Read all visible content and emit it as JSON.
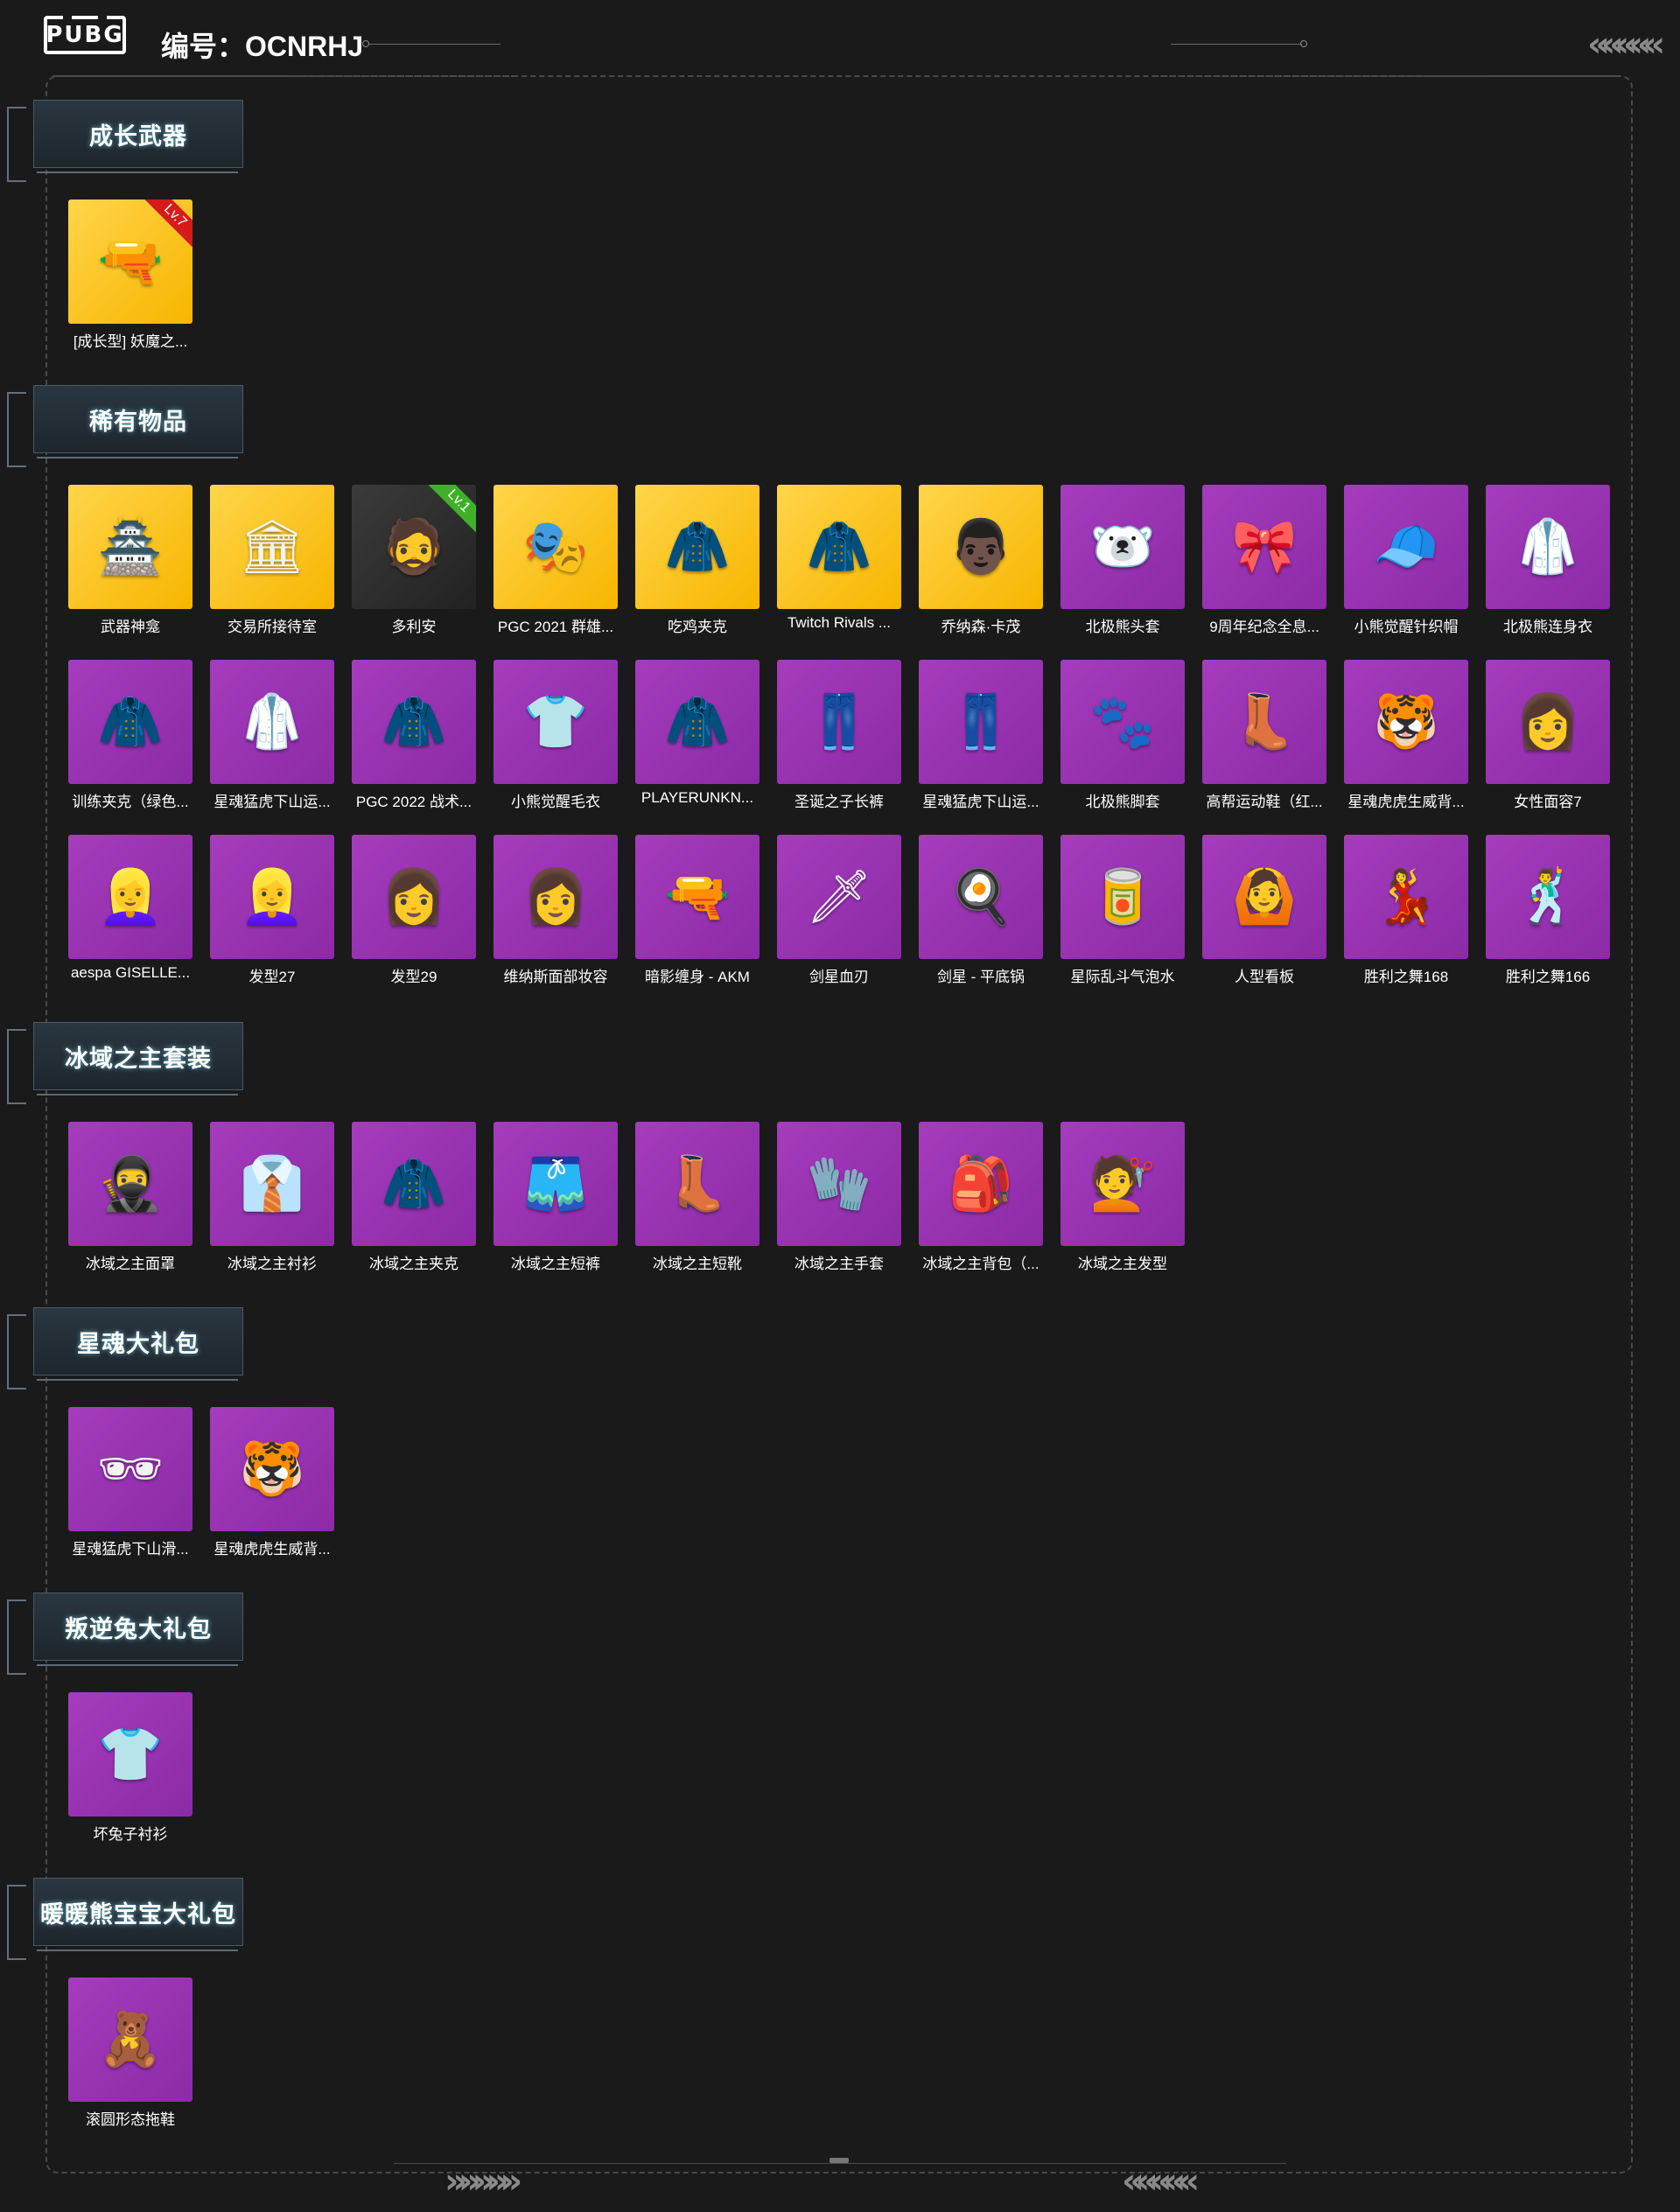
{
  "header": {
    "logo": "PUBG",
    "id_label": "编号：OCNRHJ"
  },
  "sections": [
    {
      "title": "成长武器",
      "items": [
        {
          "name": "[成长型] 妖魔之...",
          "bg": "gold",
          "icon": "🔫",
          "badge": "Lv.7",
          "badge_color": "red"
        }
      ]
    },
    {
      "title": "稀有物品",
      "items": [
        {
          "name": "武器神龛",
          "bg": "gold",
          "icon": "🏯"
        },
        {
          "name": "交易所接待室",
          "bg": "gold",
          "icon": "🏛"
        },
        {
          "name": "多利安",
          "bg": "dark",
          "icon": "🧔",
          "badge": "Lv.1",
          "badge_color": "green"
        },
        {
          "name": "PGC 2021 群雄...",
          "bg": "gold",
          "icon": "🎭"
        },
        {
          "name": "吃鸡夹克",
          "bg": "gold",
          "icon": "🧥"
        },
        {
          "name": "Twitch Rivals ...",
          "bg": "gold",
          "icon": "🧥"
        },
        {
          "name": "乔纳森·卡茂",
          "bg": "gold",
          "icon": "👨🏿"
        },
        {
          "name": "北极熊头套",
          "bg": "purple",
          "icon": "🐻‍❄️"
        },
        {
          "name": "9周年纪念全息...",
          "bg": "purple",
          "icon": "🎀"
        },
        {
          "name": "小熊觉醒针织帽",
          "bg": "purple",
          "icon": "🧢"
        },
        {
          "name": "北极熊连身衣",
          "bg": "purple",
          "icon": "🥼"
        },
        {
          "name": "训练夹克（绿色...",
          "bg": "purple",
          "icon": "🧥"
        },
        {
          "name": "星魂猛虎下山运...",
          "bg": "purple",
          "icon": "🥼"
        },
        {
          "name": "PGC 2022 战术...",
          "bg": "purple",
          "icon": "🧥"
        },
        {
          "name": "小熊觉醒毛衣",
          "bg": "purple",
          "icon": "👕"
        },
        {
          "name": "PLAYERUNKN...",
          "bg": "purple",
          "icon": "🧥"
        },
        {
          "name": "圣诞之子长裤",
          "bg": "purple",
          "icon": "👖"
        },
        {
          "name": "星魂猛虎下山运...",
          "bg": "purple",
          "icon": "👖"
        },
        {
          "name": "北极熊脚套",
          "bg": "purple",
          "icon": "🐾"
        },
        {
          "name": "高帮运动鞋（红...",
          "bg": "purple",
          "icon": "👢"
        },
        {
          "name": "星魂虎虎生威背...",
          "bg": "purple",
          "icon": "🐯"
        },
        {
          "name": "女性面容7",
          "bg": "purple",
          "icon": "👩"
        },
        {
          "name": "aespa GISELLE...",
          "bg": "purple",
          "icon": "👱‍♀️"
        },
        {
          "name": "发型27",
          "bg": "purple",
          "icon": "👱‍♀️"
        },
        {
          "name": "发型29",
          "bg": "purple",
          "icon": "👩"
        },
        {
          "name": "维纳斯面部妆容",
          "bg": "purple",
          "icon": "👩"
        },
        {
          "name": "暗影缠身 - AKM",
          "bg": "purple",
          "icon": "🔫"
        },
        {
          "name": "剑星血刃",
          "bg": "purple",
          "icon": "🗡"
        },
        {
          "name": "剑星 - 平底锅",
          "bg": "purple",
          "icon": "🍳"
        },
        {
          "name": "星际乱斗气泡水",
          "bg": "purple",
          "icon": "🥫"
        },
        {
          "name": "人型看板",
          "bg": "purple",
          "icon": "🙆"
        },
        {
          "name": "胜利之舞168",
          "bg": "purple",
          "icon": "💃"
        },
        {
          "name": "胜利之舞166",
          "bg": "purple",
          "icon": "🕺"
        }
      ]
    },
    {
      "title": "冰域之主套装",
      "items": [
        {
          "name": "冰域之主面罩",
          "bg": "purple",
          "icon": "🥷"
        },
        {
          "name": "冰域之主衬衫",
          "bg": "purple",
          "icon": "👔"
        },
        {
          "name": "冰域之主夹克",
          "bg": "purple",
          "icon": "🧥"
        },
        {
          "name": "冰域之主短裤",
          "bg": "purple",
          "icon": "🩳"
        },
        {
          "name": "冰域之主短靴",
          "bg": "purple",
          "icon": "👢"
        },
        {
          "name": "冰域之主手套",
          "bg": "purple",
          "icon": "🧤"
        },
        {
          "name": "冰域之主背包（...",
          "bg": "purple",
          "icon": "🎒"
        },
        {
          "name": "冰域之主发型",
          "bg": "purple",
          "icon": "💇"
        }
      ]
    },
    {
      "title": "星魂大礼包",
      "items": [
        {
          "name": "星魂猛虎下山滑...",
          "bg": "purple",
          "icon": "🕶"
        },
        {
          "name": "星魂虎虎生威背...",
          "bg": "purple",
          "icon": "🐯"
        }
      ]
    },
    {
      "title": "叛逆兔大礼包",
      "items": [
        {
          "name": "坏兔子衬衫",
          "bg": "purple",
          "icon": "👕"
        }
      ]
    },
    {
      "title": "暖暖熊宝宝大礼包",
      "items": [
        {
          "name": "滚圆形态拖鞋",
          "bg": "purple",
          "icon": "🧸"
        }
      ]
    }
  ]
}
